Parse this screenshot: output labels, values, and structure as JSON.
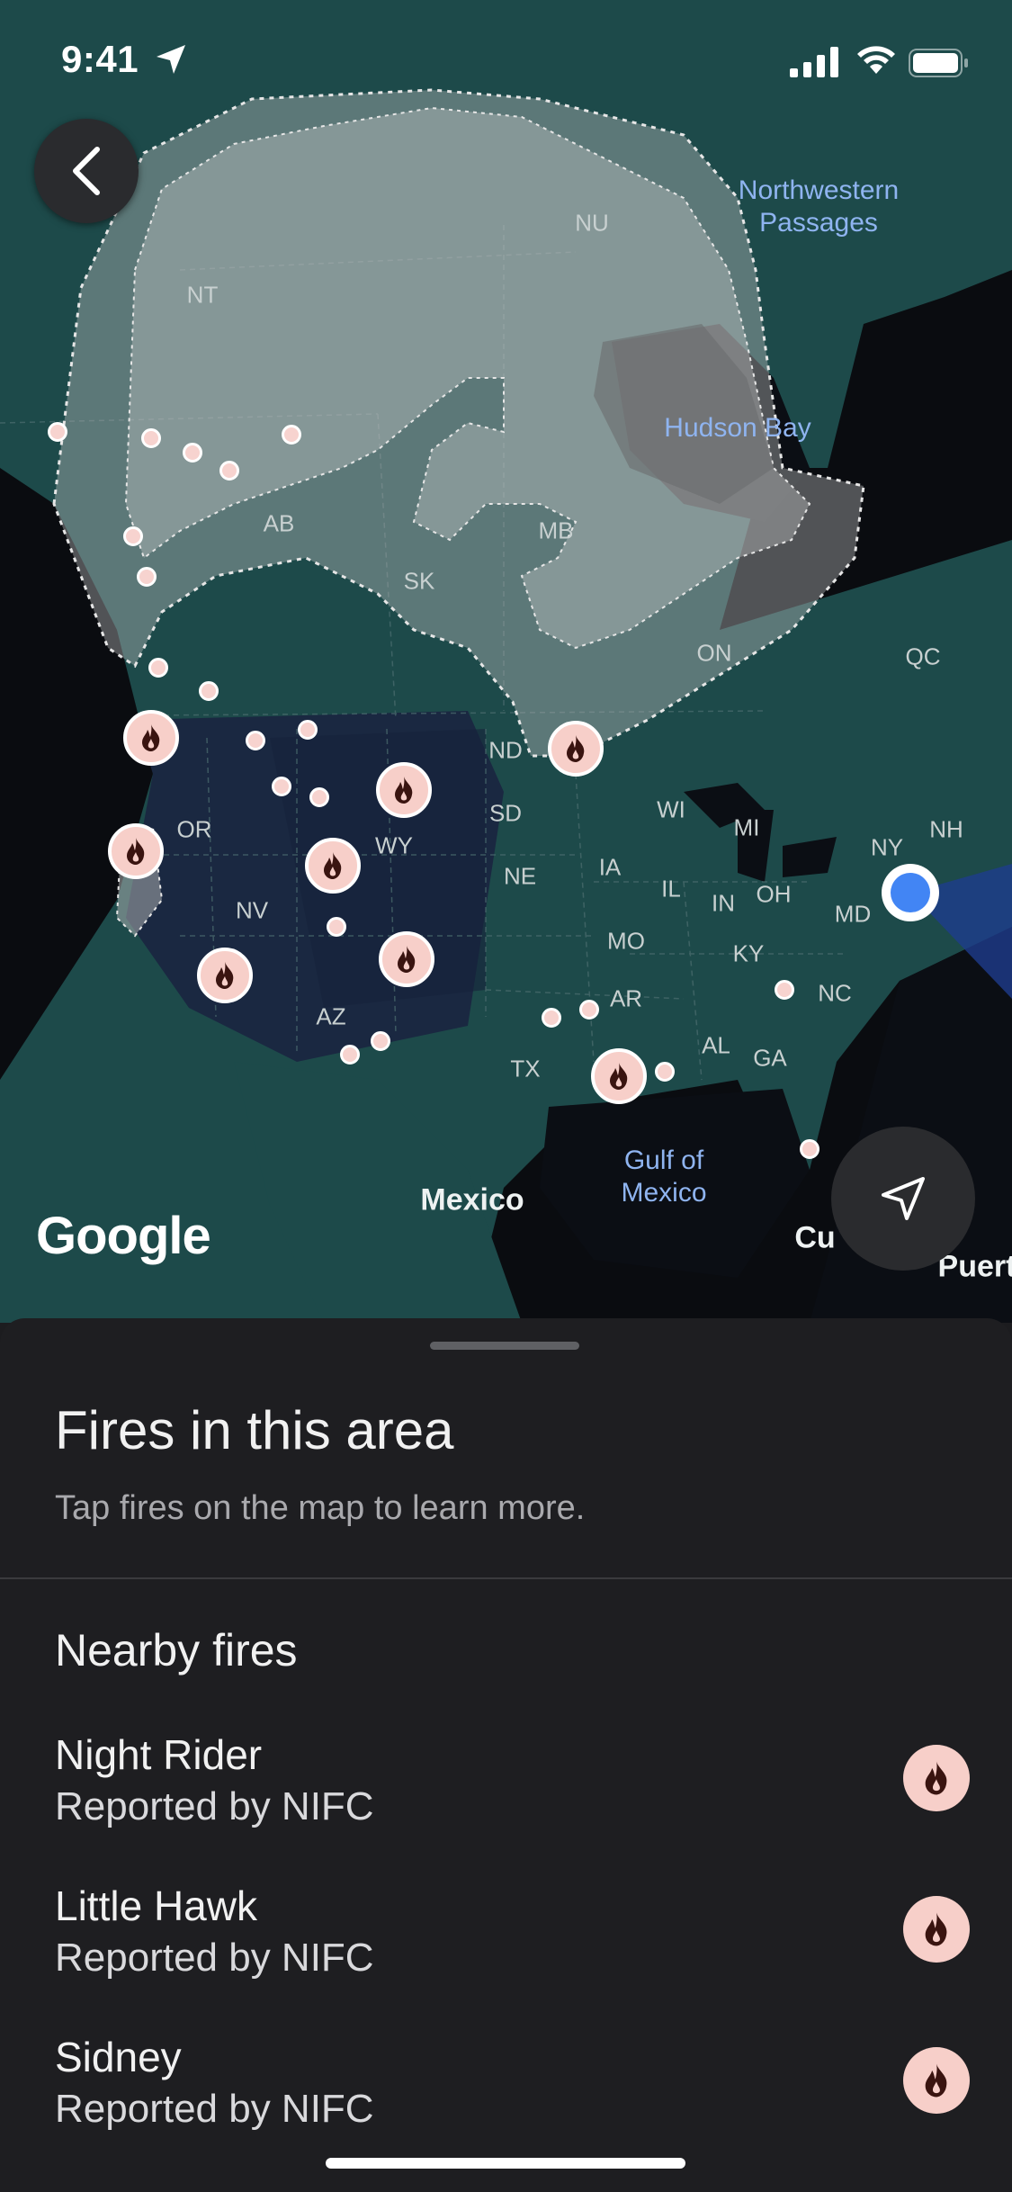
{
  "status_bar": {
    "time": "9:41"
  },
  "map": {
    "attribution": "Google",
    "labels": {
      "water": [
        "Northwestern\nPassages",
        "Hudson Bay",
        "Gulf of\nMexico"
      ],
      "country": [
        "Mexico",
        "Cu",
        "Puert"
      ],
      "regions": [
        "NU",
        "NT",
        "AB",
        "SK",
        "MB",
        "ON",
        "QC",
        "ND",
        "SD",
        "WY",
        "OR",
        "NV",
        "NE",
        "IA",
        "WI",
        "MI",
        "IL",
        "IN",
        "OH",
        "NY",
        "NH",
        "MD",
        "MO",
        "KY",
        "AR",
        "AZ",
        "TX",
        "AL",
        "GA",
        "NC"
      ]
    }
  },
  "sheet": {
    "title": "Fires in this area",
    "subtitle": "Tap fires on the map to learn more.",
    "section_title": "Nearby fires",
    "fires": [
      {
        "name": "Night Rider",
        "source": "Reported by NIFC"
      },
      {
        "name": "Little Hawk",
        "source": "Reported by NIFC"
      },
      {
        "name": "Sidney",
        "source": "Reported by NIFC"
      }
    ]
  },
  "colors": {
    "fire_marker": "#f7cfc9",
    "user_location": "#4285f4",
    "land": "#1d4a4a",
    "smoke": "#b5b8b8"
  }
}
